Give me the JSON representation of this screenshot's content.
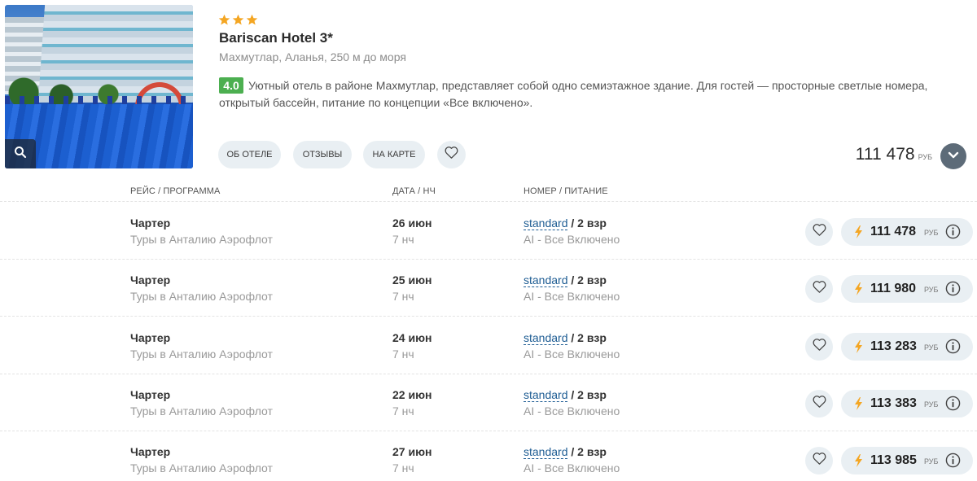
{
  "hotel": {
    "stars": 3,
    "star_color": "#f4a623",
    "name": "Bariscan Hotel 3*",
    "location": "Махмутлар, Аланья, 250 м до моря",
    "rating": "4.0",
    "rating_color": "#4caf50",
    "description": "Уютный отель в районе Махмутлар, представляет собой одно семиэтажное здание. Для гостей — просторные светлые номера, открытый бассейн, питание по концепции «Все включено».",
    "buttons": {
      "about": "ОБ ОТЕЛЕ",
      "reviews": "ОТЗЫВЫ",
      "map": "НА КАРТЕ"
    },
    "min_price": "111 478",
    "currency": "РУБ",
    "icons": {
      "photo_zoom": "search-icon",
      "favorite": "heart-icon",
      "expand": "chevron-down-icon"
    }
  },
  "table": {
    "headers": {
      "flight": "РЕЙС / ПРОГРАММА",
      "date": "ДАТА / НЧ",
      "room": "НОМЕР / ПИТАНИЕ"
    },
    "rows": [
      {
        "flight": "Чартер",
        "program": "Туры в Анталию Аэрофлот",
        "date": "26 июн",
        "nights": "7 нч",
        "room": "standard",
        "guests": " / 2 взр",
        "meal": "AI - Все Включено",
        "price": "111 478",
        "currency": "РУБ"
      },
      {
        "flight": "Чартер",
        "program": "Туры в Анталию Аэрофлот",
        "date": "25 июн",
        "nights": "7 нч",
        "room": "standard",
        "guests": " / 2 взр",
        "meal": "AI - Все Включено",
        "price": "111 980",
        "currency": "РУБ"
      },
      {
        "flight": "Чартер",
        "program": "Туры в Анталию Аэрофлот",
        "date": "24 июн",
        "nights": "7 нч",
        "room": "standard",
        "guests": " / 2 взр",
        "meal": "AI - Все Включено",
        "price": "113 283",
        "currency": "РУБ"
      },
      {
        "flight": "Чартер",
        "program": "Туры в Анталию Аэрофлот",
        "date": "22 июн",
        "nights": "7 нч",
        "room": "standard",
        "guests": " / 2 взр",
        "meal": "AI - Все Включено",
        "price": "113 383",
        "currency": "РУБ"
      },
      {
        "flight": "Чартер",
        "program": "Туры в Анталию Аэрофлот",
        "date": "27 июн",
        "nights": "7 нч",
        "room": "standard",
        "guests": " / 2 взр",
        "meal": "AI - Все Включено",
        "price": "113 985",
        "currency": "РУБ"
      }
    ],
    "row_icons": {
      "favorite": "heart-icon",
      "price_bolt": "lightning-icon",
      "info": "info-icon"
    },
    "bolt_color": "#f4a623"
  }
}
